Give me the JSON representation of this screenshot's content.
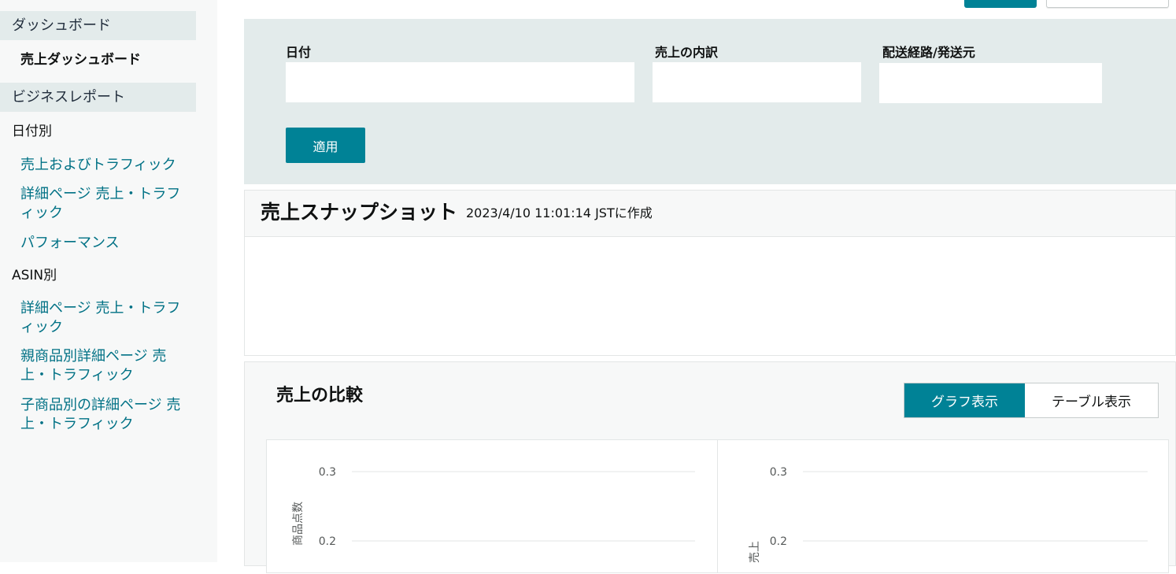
{
  "sidebar": {
    "dashboard_section": "ダッシュボード",
    "dashboard_active": "売上ダッシュボード",
    "reports_section": "ビジネスレポート",
    "by_date_group": "日付別",
    "by_date_links": [
      "売上およびトラフィック",
      "詳細ページ 売上・トラフィック",
      "パフォーマンス"
    ],
    "by_asin_group": "ASIN別",
    "by_asin_links": [
      "詳細ページ 売上・トラフィック",
      "親商品別詳細ページ 売上・トラフィック",
      "子商品別の詳細ページ 売上・トラフィック"
    ]
  },
  "filters": {
    "date_label": "日付",
    "date_value": "",
    "breakdown_label": "売上の内訳",
    "breakdown_value": "",
    "channel_label": "配送経路/発送元",
    "channel_value": "",
    "apply_label": "適用"
  },
  "snapshot": {
    "title": "売上スナップショット",
    "created": "2023/4/10 11:01:14 JSTに作成"
  },
  "comparison": {
    "title": "売上の比較",
    "graph_view_label": "グラフ表示",
    "table_view_label": "テーブル表示"
  },
  "colors": {
    "accent": "#008296",
    "link": "#007185",
    "panel": "#e3ebeb"
  },
  "chart_data": [
    {
      "type": "line",
      "ylabel": "商品点数",
      "y_ticks": [
        "0.3",
        "0.2"
      ],
      "series": []
    },
    {
      "type": "line",
      "ylabel": "売上",
      "y_ticks": [
        "0.3",
        "0.2"
      ],
      "series": []
    }
  ]
}
